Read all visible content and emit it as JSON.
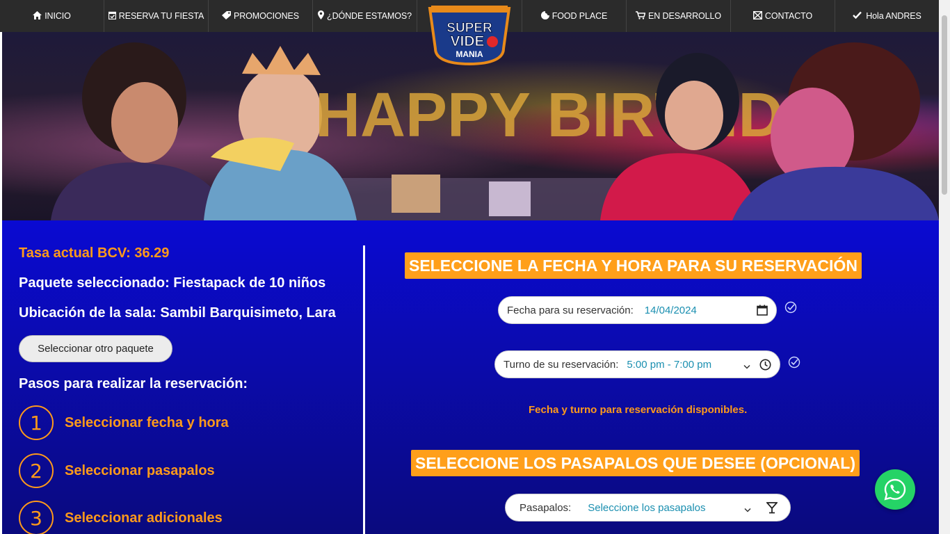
{
  "nav": {
    "inicio": "INICIO",
    "reserva": "RESERVA TU FIESTA",
    "promociones": "PROMOCIONES",
    "donde": "¿DÓNDE ESTAMOS?",
    "food": "FOOD PLACE",
    "desarrollo": "EN DESARROLLO",
    "contacto": "CONTACTO",
    "usuario": "Hola ANDRES"
  },
  "logo": {
    "line1": "SUPER",
    "line2": "VIDE",
    "line3": "MANIA"
  },
  "hero": {
    "balloons": "HAPPY BIRTHDAY"
  },
  "left": {
    "rate": "Tasa actual BCV: 36.29",
    "package": "Paquete seleccionado: Fiestapack de 10 niños",
    "location": "Ubicación de la sala: Sambil Barquisimeto, Lara",
    "other_button": "Seleccionar otro paquete",
    "steps_title": "Pasos para realizar la reservación:",
    "steps": [
      {
        "num": "1",
        "label": "Seleccionar fecha y hora"
      },
      {
        "num": "2",
        "label": "Seleccionar pasapalos"
      },
      {
        "num": "3",
        "label": "Seleccionar adicionales"
      }
    ]
  },
  "right": {
    "date_section_title": "SELECCIONE LA FECHA Y HORA PARA SU RESERVACIÓN",
    "date_label": "Fecha para su reservación:",
    "date_value": "14/04/2024",
    "shift_label": "Turno de su reservación:",
    "shift_value": "5:00 pm - 7:00 pm",
    "availability": "Fecha y turno para reservación disponibles.",
    "snacks_section_title": "SELECCIONE LOS PASAPALOS QUE DESEE (OPCIONAL)",
    "snacks_label": "Pasapalos:",
    "snacks_value": "Seleccione los pasapalos"
  },
  "colors": {
    "accent": "#ff9f1a",
    "nav_bg": "#2b2b2b",
    "main_bg": "#0a0ad2",
    "whatsapp": "#25d366"
  }
}
